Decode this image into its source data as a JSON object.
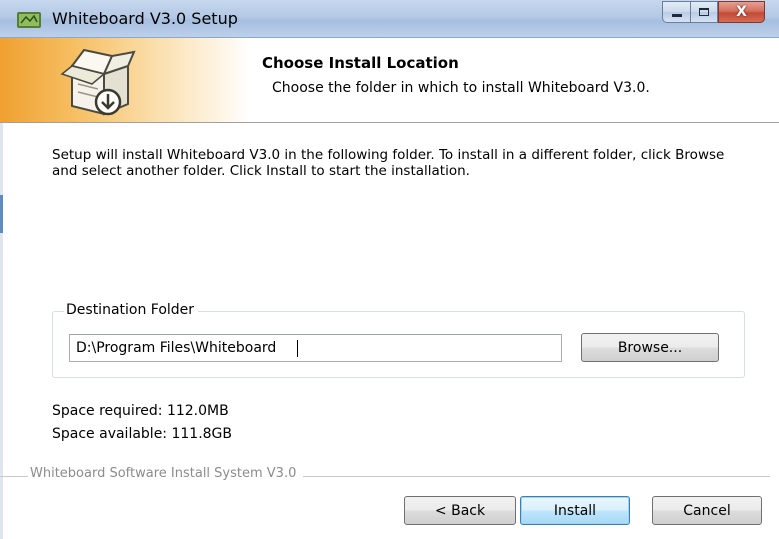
{
  "window": {
    "title": "Whiteboard V3.0 Setup",
    "close_glyph": "X"
  },
  "header": {
    "title": "Choose Install Location",
    "subtitle": "Choose the folder in which to install Whiteboard V3.0."
  },
  "body": {
    "intro": "Setup will install Whiteboard V3.0 in the following folder. To install in a different folder, click Browse and select another folder. Click Install to start the installation."
  },
  "destination": {
    "group_label": "Destination Folder",
    "path_value": "D:\\Program Files\\Whiteboard",
    "browse_label": "Browse..."
  },
  "space": {
    "required": "Space required: 112.0MB",
    "available": "Space available: 111.8GB"
  },
  "footer": {
    "branding": "Whiteboard Software Install System V3.0",
    "back_label": "< Back",
    "install_label": "Install",
    "cancel_label": "Cancel"
  },
  "colors": {
    "header_accent": "#f0a030",
    "default_button_border": "#3c7fb1",
    "close_button": "#c24a36"
  },
  "icons": {
    "app": "whiteboard-app-icon",
    "header": "install-box-icon",
    "minimize": "minimize-icon",
    "maximize": "maximize-icon",
    "close": "close-icon"
  }
}
